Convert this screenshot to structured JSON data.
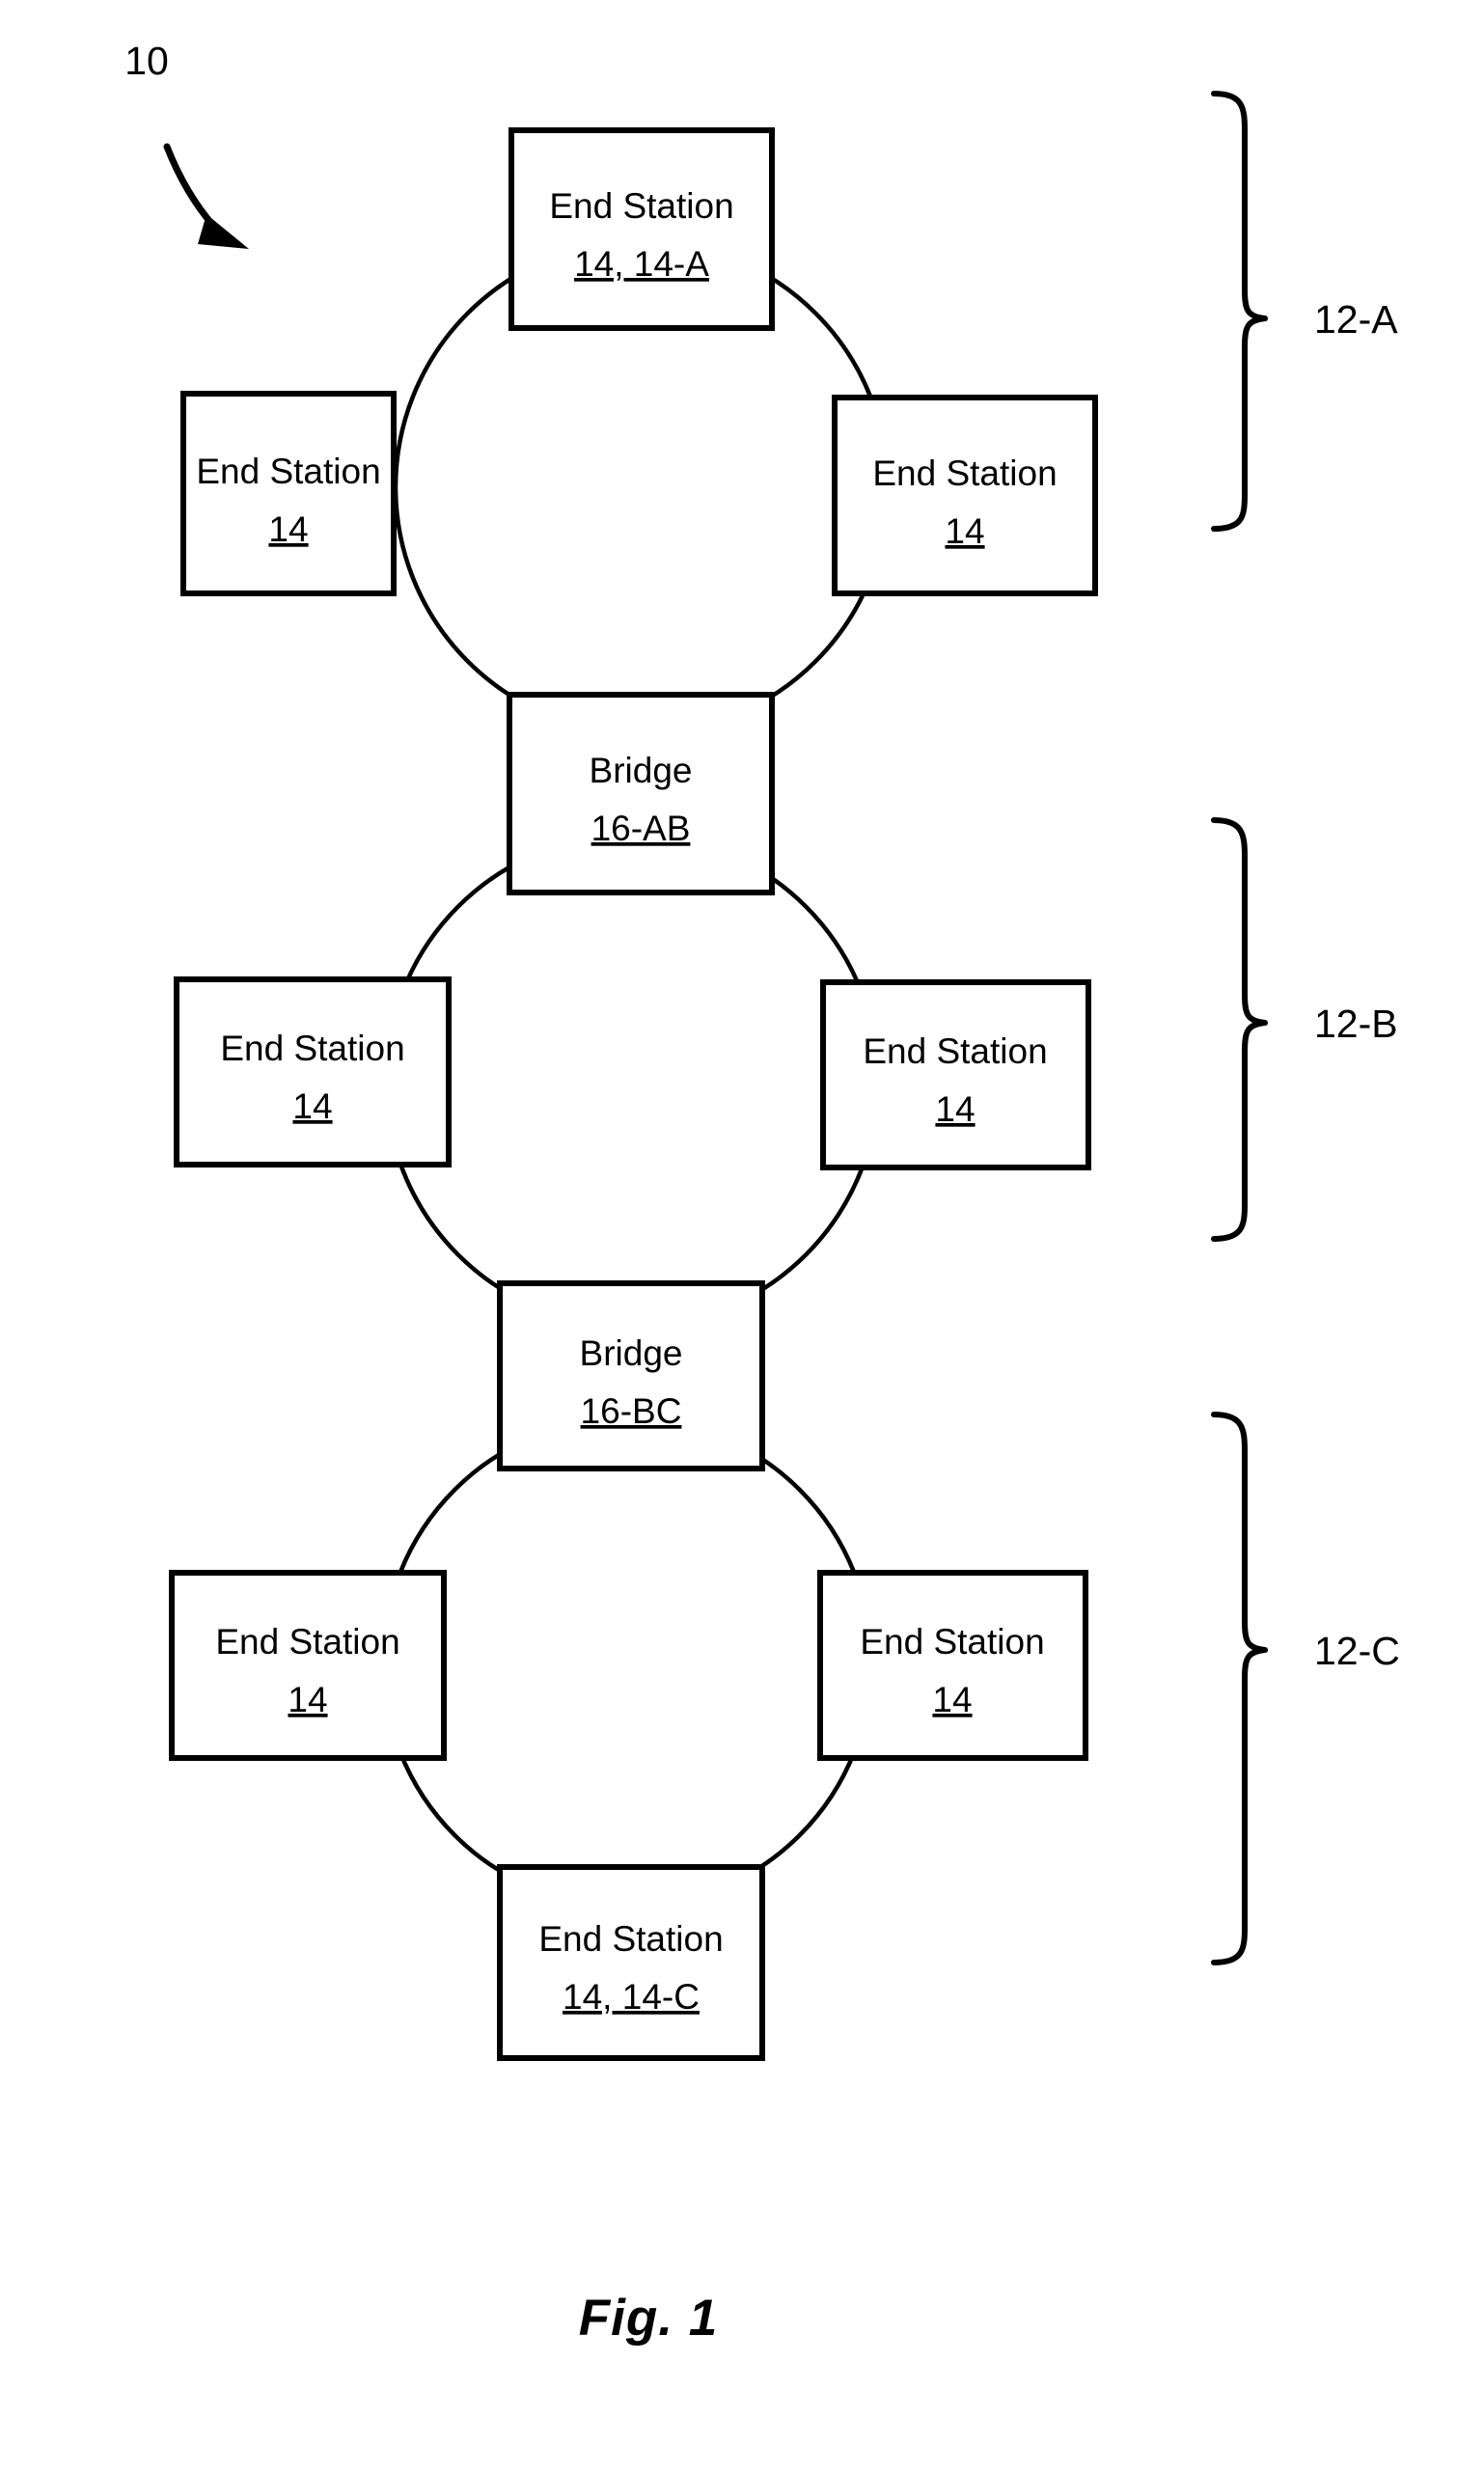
{
  "figure": {
    "caption": "Fig. 1",
    "system_callout": "10"
  },
  "rings": [
    {
      "id": "ring-a",
      "bracket_label": "12-A",
      "nodes": [
        {
          "pos": "top",
          "title": "End Station",
          "ref": "14, 14-A"
        },
        {
          "pos": "left",
          "title": "End Station",
          "ref": "14"
        },
        {
          "pos": "right",
          "title": "End Station",
          "ref": "14"
        },
        {
          "pos": "bottom",
          "title": "Bridge",
          "ref": "16-AB"
        }
      ]
    },
    {
      "id": "ring-b",
      "bracket_label": "12-B",
      "nodes": [
        {
          "pos": "top",
          "title": "Bridge",
          "ref": "16-AB"
        },
        {
          "pos": "left",
          "title": "End Station",
          "ref": "14"
        },
        {
          "pos": "right",
          "title": "End Station",
          "ref": "14"
        },
        {
          "pos": "bottom",
          "title": "Bridge",
          "ref": "16-BC"
        }
      ]
    },
    {
      "id": "ring-c",
      "bracket_label": "12-C",
      "nodes": [
        {
          "pos": "top",
          "title": "Bridge",
          "ref": "16-BC"
        },
        {
          "pos": "left",
          "title": "End Station",
          "ref": "14"
        },
        {
          "pos": "right",
          "title": "End Station",
          "ref": "14"
        },
        {
          "pos": "bottom",
          "title": "End Station",
          "ref": "14, 14-C"
        }
      ]
    }
  ],
  "colors": {
    "ink": "#000000",
    "paper": "#ffffff"
  }
}
